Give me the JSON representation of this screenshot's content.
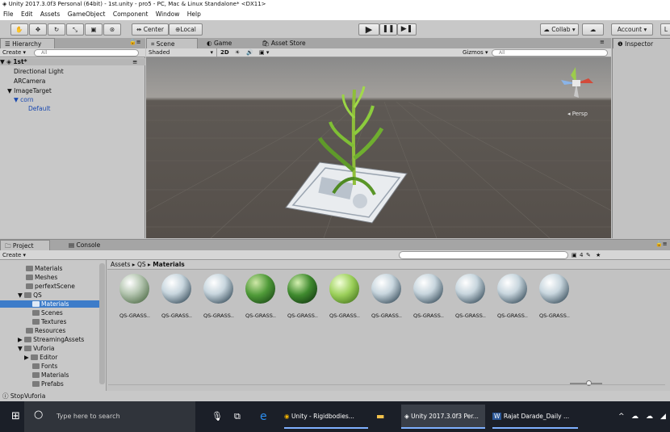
{
  "window": {
    "title": "Unity 2017.3.0f3 Personal (64bit) - 1st.unity - pro5 - PC, Mac & Linux Standalone* <DX11>"
  },
  "menu": [
    "File",
    "Edit",
    "Assets",
    "GameObject",
    "Component",
    "Window",
    "Help"
  ],
  "toolbar": {
    "pivot": "Center",
    "space": "Local",
    "collab": "Collab ▾",
    "account": "Account ▾",
    "layers": "L"
  },
  "hierarchy": {
    "tab": "Hierarchy",
    "create": "Create ▾",
    "search": "All",
    "scene": "1st*",
    "items": [
      "Directional Light",
      "ARCamera",
      "ImageTarget",
      "corn",
      "Default"
    ]
  },
  "scene_view": {
    "tabs": [
      "Scene",
      "Game",
      "Asset Store"
    ],
    "shading": "Shaded",
    "mode_2d": "2D",
    "gizmos": "Gizmos ▾",
    "search": "All",
    "persp": "Persp"
  },
  "inspector": {
    "tab": "Inspector"
  },
  "project": {
    "tabs": [
      "Project",
      "Console"
    ],
    "create": "Create ▾",
    "breadcrumb": [
      "Assets",
      "QS",
      "Materials"
    ],
    "tree": [
      "Materials",
      "Meshes",
      "perfextScene",
      "QS",
      "Materials",
      "Scenes",
      "Textures",
      "Resources",
      "StreamingAssets",
      "Vuforia",
      "Editor",
      "Fonts",
      "Materials",
      "Prefabs"
    ],
    "assets": [
      "QS-GRASS..",
      "QS-GRASS..",
      "QS-GRASS..",
      "QS-GRASS..",
      "QS-GRASS..",
      "QS-GRASS..",
      "QS-GRASS..",
      "QS-GRASS..",
      "QS-GRASS..",
      "QS-GRASS..",
      "QS-GRASS.."
    ],
    "badge": "4"
  },
  "status": {
    "text": "StopVuforia"
  },
  "taskbar": {
    "search": "Type here to search",
    "apps": [
      "Unity - Rigidbodies...",
      "Unity 2017.3.0f3 Per...",
      "Rajat Darade_Daily ..."
    ]
  },
  "colors": {
    "selection": "#3d7cc9",
    "taskbar": "#1b1f28",
    "scene_bg": "#5a5651"
  }
}
